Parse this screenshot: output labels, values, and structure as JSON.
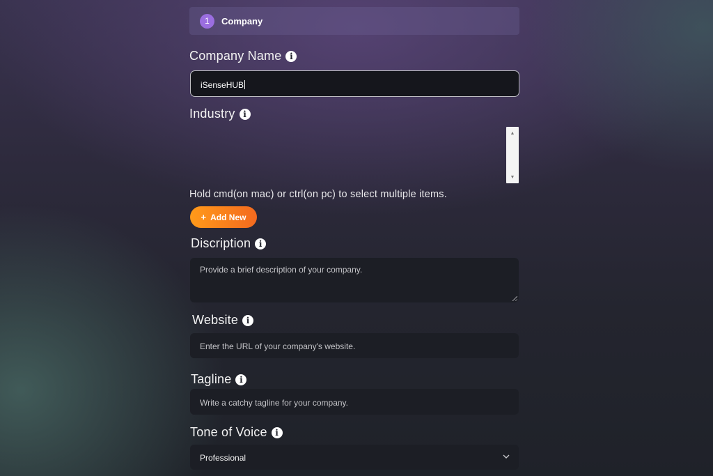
{
  "step": {
    "number": "1",
    "label": "Company"
  },
  "form": {
    "company_name": {
      "label": "Company Name",
      "value": "iSenseHUB"
    },
    "industry": {
      "label": "Industry",
      "hint": "Hold cmd(on mac) or ctrl(on pc) to select multiple items."
    },
    "add_new": {
      "label": "Add New",
      "icon": "plus-icon"
    },
    "description": {
      "label": "Discription",
      "placeholder": "Provide a brief description of your company."
    },
    "website": {
      "label": "Website",
      "placeholder": "Enter the URL of your company's website."
    },
    "tagline": {
      "label": "Tagline",
      "placeholder": "Write a catchy tagline for your company."
    },
    "tone_of_voice": {
      "label": "Tone of Voice",
      "selected": "Professional"
    },
    "info_glyph": "i"
  },
  "colors": {
    "accent_purple": "#9b6ee0",
    "button_orange_start": "#ff9a1a",
    "button_orange_end": "#f46a1f",
    "field_background": "#1c1e25"
  }
}
